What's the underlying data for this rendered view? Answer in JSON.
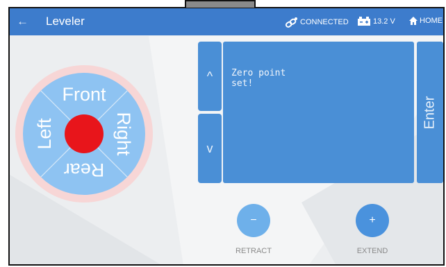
{
  "appbar": {
    "back_icon": "arrow-left-icon",
    "title": "Leveler",
    "connection": "CONNECTED",
    "voltage": "13.2 V",
    "home": "HOME"
  },
  "dpad": {
    "front": "Front",
    "right": "Right",
    "rear": "Rear",
    "left": "Left"
  },
  "controls": {
    "up": "^",
    "down": "v",
    "display_text": "Zero point\nset!",
    "enter": "Enter",
    "retract_symbol": "−",
    "extend_symbol": "+",
    "retract_label": "RETRACT",
    "extend_label": "EXTEND"
  },
  "colors": {
    "appbar": "#3d7ccc",
    "panel": "#4a8fd6",
    "dpad_fill": "#8ec3f2",
    "dpad_ring": "#f7d6d6",
    "center_dot": "#e8151b"
  }
}
